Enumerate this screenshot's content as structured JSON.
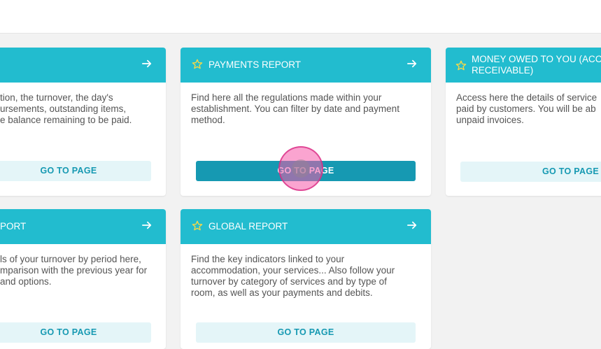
{
  "colors": {
    "page_background": "#f2f2f2",
    "card_header": "#22bccf",
    "button_active": "#1699b2",
    "button_light": "#e4f5f8",
    "star": "#f2d84a"
  },
  "cards": [
    {
      "title": "",
      "desc_lines": [
        "tion, the turnover, the day's",
        "ursements, outstanding items,",
        "e balance remaining to be paid."
      ],
      "button": "GO TO PAGE"
    },
    {
      "title": "PAYMENTS REPORT",
      "desc_lines": [
        "Find here all the regulations made within your",
        "establishment. You can filter by date and payment",
        "method."
      ],
      "button": "GO TO PAGE"
    },
    {
      "title_lines": [
        "MONEY OWED TO YOU (ACCO",
        "RECEIVABLE)"
      ],
      "desc_lines": [
        "Access here the details of service",
        "paid by customers. You will be ab",
        "unpaid invoices."
      ],
      "button": "GO TO PAGE"
    },
    {
      "title": "PORT",
      "desc_lines": [
        "ls of your turnover by period here,",
        "mparison with the previous year for",
        "and options."
      ],
      "button": "GO TO PAGE"
    },
    {
      "title": "GLOBAL REPORT",
      "desc_lines": [
        "Find the key indicators linked to your",
        "accommodation, your services... Also follow your",
        "turnover by category of services and by type of",
        "room, as well as your payments and debits."
      ],
      "button": "GO TO PAGE"
    }
  ],
  "icons": {
    "favorite": "star-outline-icon",
    "navigate": "arrow-right-icon"
  }
}
